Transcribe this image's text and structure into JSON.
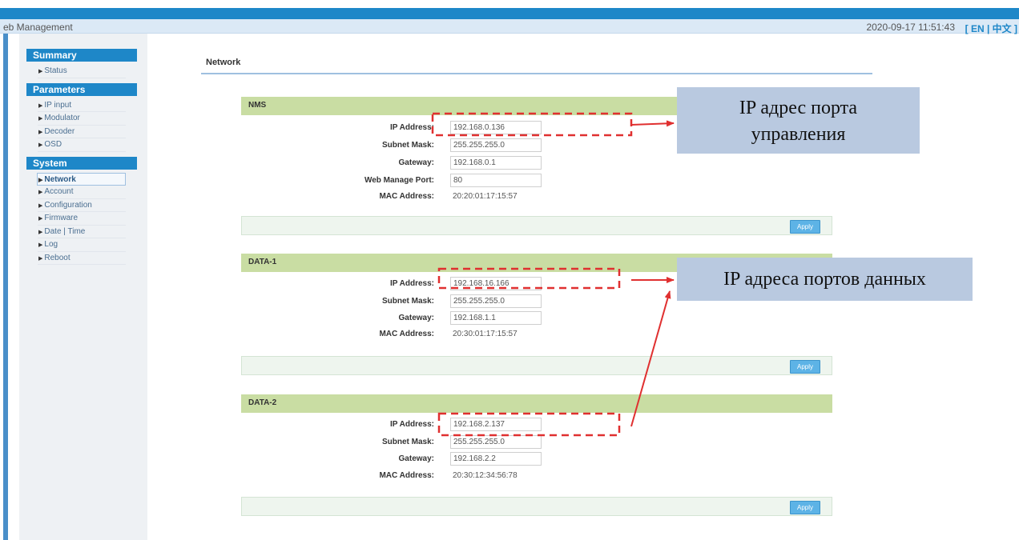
{
  "header": {
    "app_title": "eb Management",
    "datetime": "2020-09-17 11:51:43",
    "lang_en": "[ EN",
    "lang_sep": " | ",
    "lang_zh": "中文 ]"
  },
  "sidebar": {
    "groups": [
      {
        "title": "Summary",
        "items": [
          {
            "label": "Status"
          }
        ]
      },
      {
        "title": "Parameters",
        "items": [
          {
            "label": "IP input"
          },
          {
            "label": "Modulator"
          },
          {
            "label": "Decoder"
          },
          {
            "label": "OSD"
          }
        ]
      },
      {
        "title": "System",
        "items": [
          {
            "label": "Network",
            "active": true
          },
          {
            "label": "Account"
          },
          {
            "label": "Configuration"
          },
          {
            "label": "Firmware"
          },
          {
            "label": "Date | Time"
          },
          {
            "label": "Log"
          },
          {
            "label": "Reboot"
          }
        ]
      }
    ]
  },
  "main": {
    "page_title": "Network",
    "apply_label": "Apply",
    "sections": {
      "nms": {
        "title": "NMS",
        "ip_label": "IP Address:",
        "ip_value": "192.168.0.136",
        "mask_label": "Subnet Mask:",
        "mask_value": "255.255.255.0",
        "gw_label": "Gateway:",
        "gw_value": "192.168.0.1",
        "port_label": "Web Manage Port:",
        "port_value": "80",
        "mac_label": "MAC Address:",
        "mac_value": "20:20:01:17:15:57"
      },
      "data1": {
        "title": "DATA-1",
        "ip_label": "IP Address:",
        "ip_value": "192.168.16.166",
        "mask_label": "Subnet Mask:",
        "mask_value": "255.255.255.0",
        "gw_label": "Gateway:",
        "gw_value": "192.168.1.1",
        "mac_label": "MAC Address:",
        "mac_value": "20:30:01:17:15:57"
      },
      "data2": {
        "title": "DATA-2",
        "ip_label": "IP Address:",
        "ip_value": "192.168.2.137",
        "mask_label": "Subnet Mask:",
        "mask_value": "255.255.255.0",
        "gw_label": "Gateway:",
        "gw_value": "192.168.2.2",
        "mac_label": "MAC Address:",
        "mac_value": "20:30:12:34:56:78"
      }
    }
  },
  "annotations": {
    "nms_callout_line1": "IP адрес порта",
    "nms_callout_line2": "управления",
    "data_callout": "IP адреса портов данных",
    "highlight_color": "#e03030",
    "callout_color": "#b9c9e0"
  },
  "colors": {
    "accent": "#1e87c8",
    "section_header": "#c9dda3",
    "apply_button": "#5db3e6"
  }
}
